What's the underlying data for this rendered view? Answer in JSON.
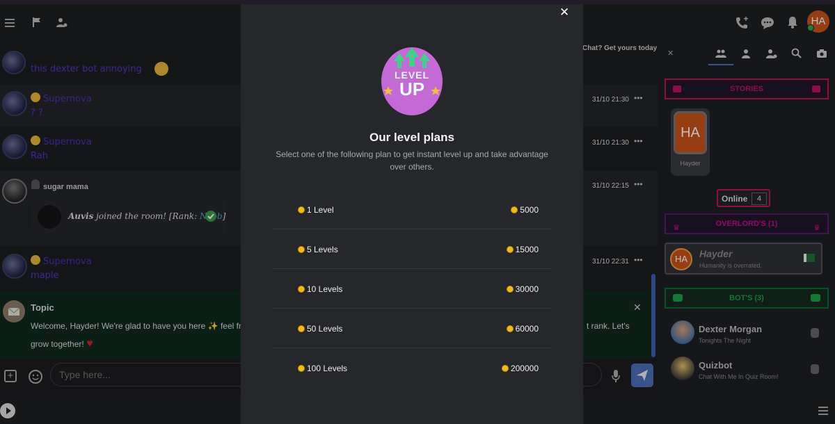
{
  "topbar": {
    "promo_text": "Chat? Get yours today",
    "avatar_initials": "HA"
  },
  "chat": {
    "messages": [
      {
        "text": "this dexter bot annoying"
      },
      {
        "user": "Supernova",
        "text": "? ?",
        "time": "31/10 21:30"
      },
      {
        "user": "Supernova",
        "text": "Rah",
        "time": "31/10 21:30"
      },
      {
        "user": "sugar mama",
        "time": "31/10 22:15",
        "join_user": "Auvis",
        "join_text": "joined the room! [Rank:",
        "join_rank": "Noob",
        "join_close": "]"
      },
      {
        "user": "Supernova",
        "text": "maple",
        "time": "31/10 22:31"
      }
    ],
    "topic": {
      "title": "Topic",
      "line1": "Welcome, Hayder! We're glad to have you here",
      "line1_cont": "feel fr",
      "line1_right": "t rank. Let's",
      "line2": "grow together!"
    },
    "composer": {
      "placeholder": "Type here..."
    }
  },
  "sidebar": {
    "stories_label": "STORIES",
    "story_initials": "HA",
    "story_name": "Hayder",
    "online_label": "Online",
    "online_count": "4",
    "overlords_label": "OVERLORD'S (1)",
    "overlord": {
      "initials": "HA",
      "name": "Hayder",
      "status": "Humanity is overrated."
    },
    "bots_label": "BOT'S (3)",
    "bots": [
      {
        "name": "Dexter Morgan",
        "status": "Tonights The Night"
      },
      {
        "name": "Quizbot",
        "status": "Chat With Me In Quiz Room!"
      }
    ]
  },
  "modal": {
    "badge_line1": "LEVEL",
    "badge_line2": "UP",
    "title": "Our level plans",
    "subtitle_line1": "Select one of the following plan to get instant level up and take advantage",
    "subtitle_line2": "over others.",
    "plans": [
      {
        "name": "1 Level",
        "price": "5000"
      },
      {
        "name": "5 Levels",
        "price": "15000"
      },
      {
        "name": "10 Levels",
        "price": "30000"
      },
      {
        "name": "50 Levels",
        "price": "60000"
      },
      {
        "name": "100 Levels",
        "price": "200000"
      }
    ]
  },
  "colors": {
    "accent": "#c4154f",
    "modal_bg": "#26272b",
    "send": "#4a6fb8"
  }
}
